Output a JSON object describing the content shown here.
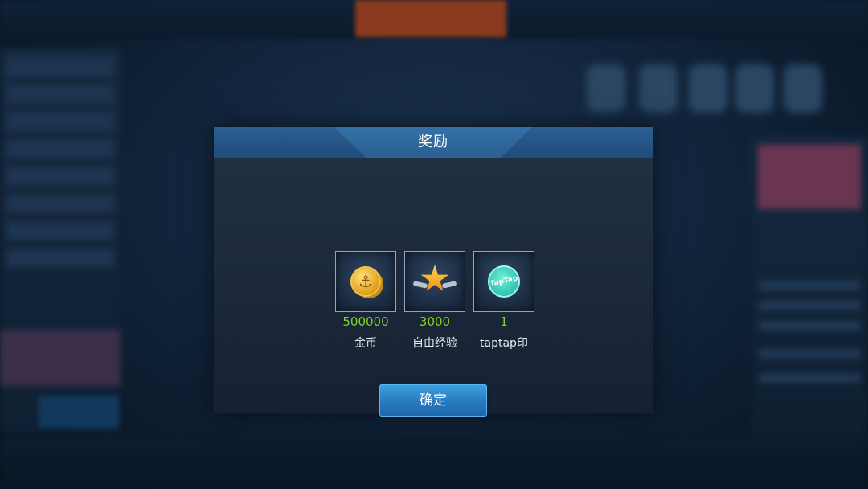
{
  "dialog": {
    "title": "奖励",
    "confirm_label": "确定"
  },
  "rewards": [
    {
      "icon": "gold-coin-icon",
      "amount": "500000",
      "name": "金币"
    },
    {
      "icon": "star-exp-icon",
      "amount": "3000",
      "name": "自由经验"
    },
    {
      "icon": "taptap-seal-icon",
      "amount": "1",
      "name": "taptap印"
    }
  ],
  "colors": {
    "amount_text": "#7ed321",
    "header_blue": "#2a5f92",
    "button_blue": "#2778bf"
  }
}
